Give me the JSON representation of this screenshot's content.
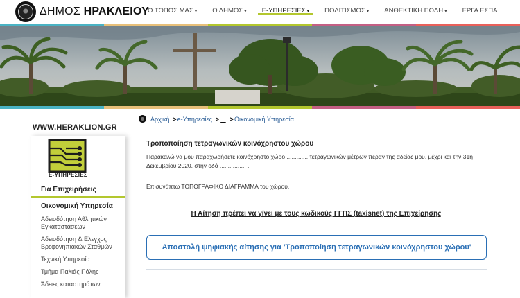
{
  "header": {
    "brand_light": "ΔΗΜΟΣ ",
    "brand_bold": "ΗΡΑΚΛΕΙΟΥ",
    "nav": [
      {
        "label": "Ο ΤΟΠΟΣ ΜΑΣ",
        "dropdown": true,
        "active": false
      },
      {
        "label": "Ο ΔΗΜΟΣ",
        "dropdown": true,
        "active": false
      },
      {
        "label": "Ε-ΥΠΗΡΕΣΙΕΣ",
        "dropdown": true,
        "active": true
      },
      {
        "label": "ΠΟΛΙΤΙΣΜΟΣ",
        "dropdown": true,
        "active": false
      },
      {
        "label": "ΑΝΘΕΚΤΙΚΗ ΠΟΛΗ",
        "dropdown": true,
        "active": false
      },
      {
        "label": "ΕΡΓΑ ΕΣΠΑ",
        "dropdown": false,
        "active": false
      }
    ]
  },
  "colors": {
    "stripe": [
      "#4ab3c4",
      "#e8c07a",
      "#b3c72e",
      "#c45f84",
      "#e9605a"
    ],
    "accent": "#b3c72e",
    "link": "#2a5d96",
    "cta": "#2a6fb5"
  },
  "sidebar": {
    "site": "WWW.HERAKLION.GR",
    "icon_label": "Ε-ΥΠΗΡΕΣΙΕΣ",
    "section": "Για Επιχειρήσεις",
    "items": [
      {
        "label": "Οικονομική Υπηρεσία",
        "current": true
      },
      {
        "label": "Αδειοδότηση Αθλητικών Εγκαταστάσεων",
        "current": false
      },
      {
        "label": "Αδειοδότηση & Ελεγχος Βρεφονηπιακών Σταθμών",
        "current": false
      },
      {
        "label": "Τεχνική Υπηρεσία",
        "current": false
      },
      {
        "label": "Τμήμα Παλιάς Πόλης",
        "current": false
      },
      {
        "label": "Άδειες καταστημάτων",
        "current": false
      }
    ]
  },
  "breadcrumb": {
    "home": "Αρχική",
    "sep": ">",
    "level1": "e-Υπηρεσίες",
    "level2": "...",
    "level3": "Οικονομική Υπηρεσία"
  },
  "main": {
    "title": "Τροποποίηση τετραγωνικών κοινόχρηστου χώρου",
    "paragraph": "Παρακαλώ να μου παραχωρήσετε κοινόχρηστο χώρο ............. τετραγωνικών μέτρων πέραν της αδείας μου, μέχρι και την 31η Δεκεμβρίου 2020, στην οδό ................ .",
    "attachment": "Επισυνάπτω ΤΟΠΟΓΡΑΦΙΚΟ ΔΙΑΓΡΑΜΜΑ του χώρου.",
    "notice": "Η Αίτηση πρέπει να γίνει με τους κωδικούς ΓΓΠΣ (taxisnet) της Επιχείρησης",
    "cta": "Αποστολή ψηφιακής αίτησης για 'Τροποποίηση τετραγωνικών κοινόχρηστου χώρου'"
  }
}
